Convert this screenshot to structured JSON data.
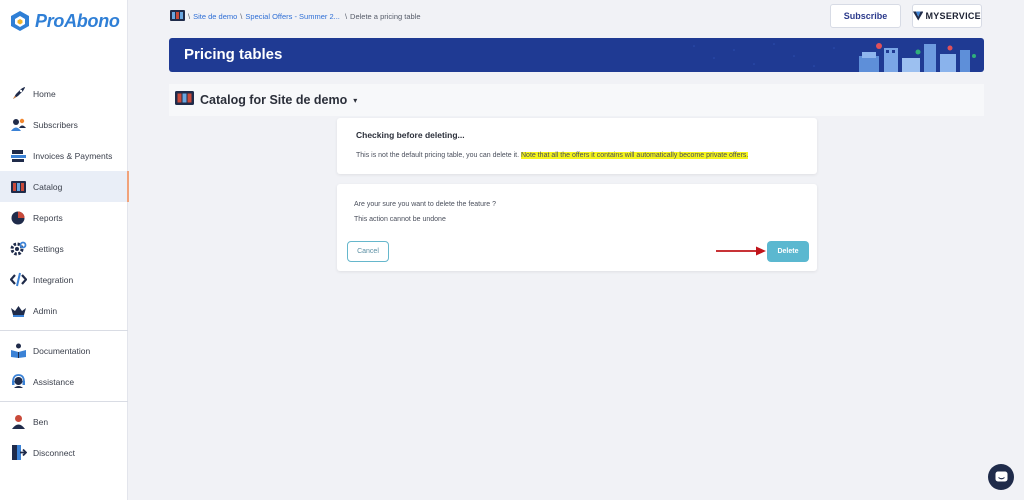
{
  "app": {
    "logo_text": "ProAbono",
    "brand_color": "#2f7fd6"
  },
  "sidebar": {
    "items": [
      {
        "label": "Home",
        "icon": "rocket-icon"
      },
      {
        "label": "Subscribers",
        "icon": "users-icon"
      },
      {
        "label": "Invoices & Payments",
        "icon": "invoice-icon"
      },
      {
        "label": "Catalog",
        "icon": "catalog-icon",
        "active": true
      },
      {
        "label": "Reports",
        "icon": "pie-chart-icon"
      },
      {
        "label": "Settings",
        "icon": "gear-icon"
      },
      {
        "label": "Integration",
        "icon": "code-icon"
      },
      {
        "label": "Admin",
        "icon": "crown-icon"
      }
    ],
    "help_items": [
      {
        "label": "Documentation",
        "icon": "book-icon"
      },
      {
        "label": "Assistance",
        "icon": "headset-icon"
      }
    ],
    "user_items": [
      {
        "label": "Ben",
        "icon": "user-icon"
      },
      {
        "label": "Disconnect",
        "icon": "logout-icon"
      }
    ]
  },
  "breadcrumb": {
    "items": [
      "Site de demo",
      "Special Offers - Summer 2...",
      "Delete a pricing table"
    ]
  },
  "topbar": {
    "subscribe_label": "Subscribe",
    "brand_label": "MYSERVICE"
  },
  "header": {
    "title": "Pricing tables"
  },
  "catalog": {
    "title": "Catalog for Site de demo"
  },
  "check_card": {
    "title": "Checking before deleting...",
    "text_plain": "This is not the default pricing table, you can delete it.",
    "text_highlight": "Note that all the offers it contains will automatically become private offers."
  },
  "confirm_card": {
    "line1": "Are your sure you want to delete the feature ?",
    "line2": "This action cannot be undone",
    "cancel_label": "Cancel",
    "delete_label": "Delete"
  },
  "colors": {
    "banner": "#1f3a93",
    "delete_button": "#5bb8d0",
    "highlight": "#f5f51c",
    "arrow": "#c0141a"
  }
}
